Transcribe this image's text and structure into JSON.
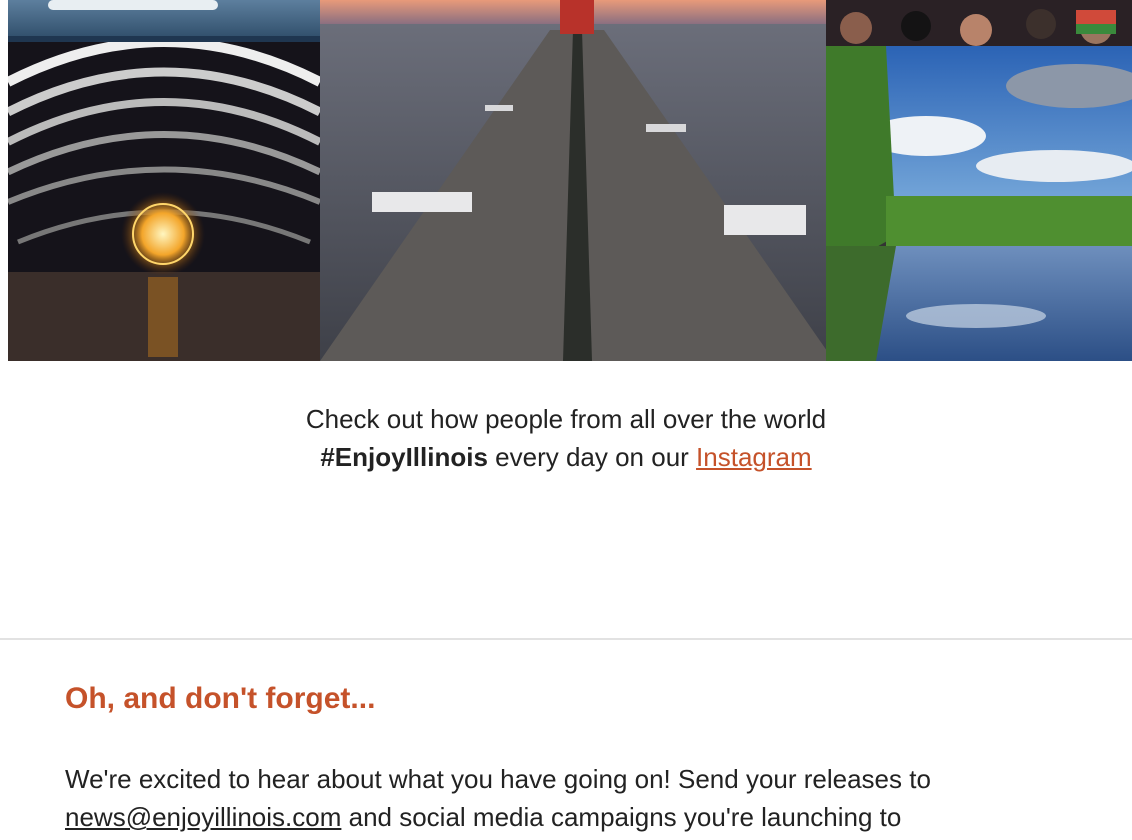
{
  "caption": {
    "line1": "Check out how people from all over the world",
    "hashtag": "#EnjoyIllinois",
    "line2_middle": " every day on our ",
    "link_label": "Instagram"
  },
  "section": {
    "heading": "Oh, and don't forget...",
    "body_start": "We're excited to hear about what you have going on! Send your releases to",
    "email_link": "news@enjoyillinois.com",
    "body_end": " and social media campaigns you're launching to"
  },
  "colors": {
    "accent": "#c5522a",
    "text": "#222222",
    "divider": "#e2e2e2"
  }
}
